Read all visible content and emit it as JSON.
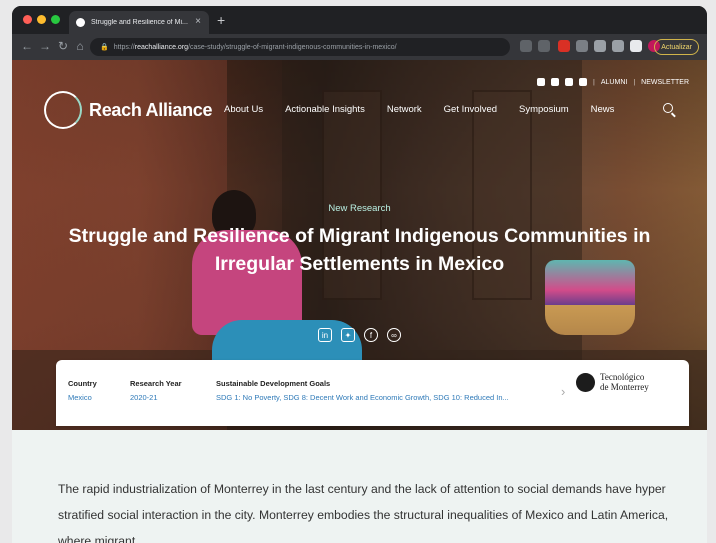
{
  "browser": {
    "tab_title": "Struggle and Resilience of Mi...",
    "tab_close": "×",
    "new_tab": "+",
    "url_host": "reachalliance.org",
    "url_prefix": "https://",
    "url_path": "/case-study/struggle-of-migrant-indigenous-communities-in-mexico/",
    "update_label": "Actualizar"
  },
  "site": {
    "logo_text": "Reach Alliance",
    "top_links": [
      "ALUMNI",
      "NEWSLETTER"
    ],
    "top_sep": "|",
    "nav": [
      "About Us",
      "Actionable Insights",
      "Network",
      "Get Involved",
      "Symposium",
      "News"
    ]
  },
  "hero": {
    "kicker": "New Research",
    "headline": "Struggle and Resilience of Migrant Indigenous Communities in Irregular Settlements in Mexico"
  },
  "info": {
    "country_label": "Country",
    "country_value": "Mexico",
    "year_label": "Research Year",
    "year_value": "2020-21",
    "sdg_label": "Sustainable Development Goals",
    "sdg_value": "SDG 1: No Poverty, SDG 8: Decent Work and Economic Growth, SDG 10: Reduced In...",
    "chevron": "›",
    "partner_line1": "Tecnológico",
    "partner_line2": "de Monterrey"
  },
  "body": {
    "paragraph": "The rapid industrialization of Monterrey in the last century and the lack of attention to social demands have hyper stratified social interaction in the city. Monterrey embodies the structural inequalities of Mexico and Latin America, where migrant"
  },
  "colors": {
    "accent_teal": "#b9efe2",
    "link_blue": "#2f7ab8",
    "page_bg": "#eef3f2"
  }
}
